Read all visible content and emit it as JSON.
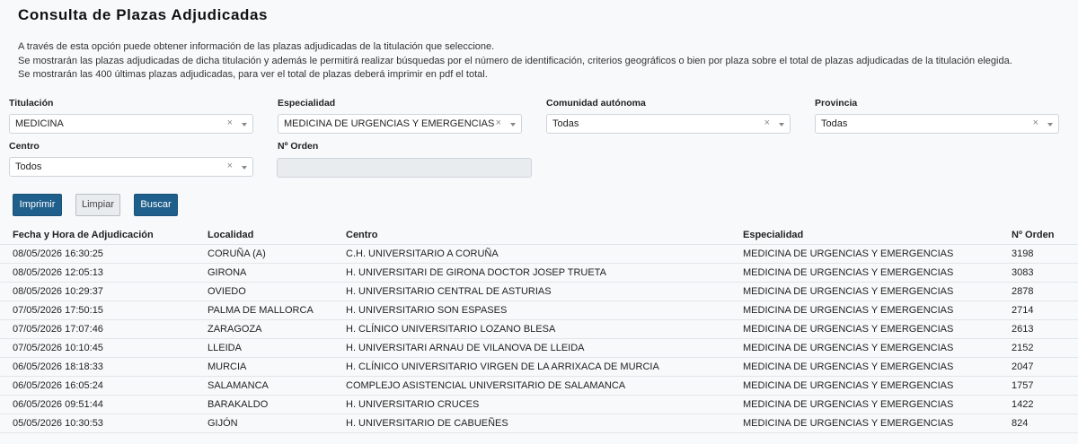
{
  "title": "Consulta de Plazas Adjudicadas",
  "intro": [
    "A través de esta opción puede obtener información de las plazas adjudicadas de la titulación que seleccione.",
    "Se mostrarán las plazas adjudicadas de dicha titulación y además le permitirá realizar búsquedas por el número de identificación, criterios geográficos o bien por plaza sobre el total de plazas adjudicadas de la titulación elegida.",
    "Se mostrarán las 400 últimas plazas adjudicadas, para ver el total de plazas deberá imprimir en pdf el total."
  ],
  "filters": {
    "titulacion": {
      "label": "Titulación",
      "value": "MEDICINA"
    },
    "especialidad": {
      "label": "Especialidad",
      "value": "MEDICINA DE URGENCIAS Y EMERGENCIAS"
    },
    "comunidad": {
      "label": "Comunidad autónoma",
      "value": "Todas"
    },
    "provincia": {
      "label": "Provincia",
      "value": "Todas"
    },
    "centro": {
      "label": "Centro",
      "value": "Todos"
    },
    "orden": {
      "label": "Nº Orden",
      "value": ""
    },
    "clear_glyph": "×"
  },
  "buttons": {
    "imprimir": "Imprimir",
    "limpiar": "Limpiar",
    "buscar": "Buscar"
  },
  "table": {
    "headers": {
      "fecha": "Fecha y Hora de Adjudicación",
      "localidad": "Localidad",
      "centro": "Centro",
      "especialidad": "Especialidad",
      "orden": "Nº Orden"
    },
    "rows": [
      {
        "fecha": "08/05/2026 16:30:25",
        "localidad": "CORUÑA (A)",
        "centro": "C.H. UNIVERSITARIO A CORUÑA",
        "especialidad": "MEDICINA DE URGENCIAS Y EMERGENCIAS",
        "orden": "3198"
      },
      {
        "fecha": "08/05/2026 12:05:13",
        "localidad": "GIRONA",
        "centro": "H. UNIVERSITARI DE GIRONA DOCTOR JOSEP TRUETA",
        "especialidad": "MEDICINA DE URGENCIAS Y EMERGENCIAS",
        "orden": "3083"
      },
      {
        "fecha": "08/05/2026 10:29:37",
        "localidad": "OVIEDO",
        "centro": "H. UNIVERSITARIO CENTRAL DE ASTURIAS",
        "especialidad": "MEDICINA DE URGENCIAS Y EMERGENCIAS",
        "orden": "2878"
      },
      {
        "fecha": "07/05/2026 17:50:15",
        "localidad": "PALMA DE MALLORCA",
        "centro": "H. UNIVERSITARIO SON ESPASES",
        "especialidad": "MEDICINA DE URGENCIAS Y EMERGENCIAS",
        "orden": "2714"
      },
      {
        "fecha": "07/05/2026 17:07:46",
        "localidad": "ZARAGOZA",
        "centro": "H. CLÍNICO UNIVERSITARIO LOZANO BLESA",
        "especialidad": "MEDICINA DE URGENCIAS Y EMERGENCIAS",
        "orden": "2613"
      },
      {
        "fecha": "07/05/2026 10:10:45",
        "localidad": "LLEIDA",
        "centro": "H. UNIVERSITARI ARNAU DE VILANOVA DE LLEIDA",
        "especialidad": "MEDICINA DE URGENCIAS Y EMERGENCIAS",
        "orden": "2152"
      },
      {
        "fecha": "06/05/2026 18:18:33",
        "localidad": "MURCIA",
        "centro": "H. CLÍNICO UNIVERSITARIO VIRGEN DE LA ARRIXACA DE MURCIA",
        "especialidad": "MEDICINA DE URGENCIAS Y EMERGENCIAS",
        "orden": "2047"
      },
      {
        "fecha": "06/05/2026 16:05:24",
        "localidad": "SALAMANCA",
        "centro": "COMPLEJO ASISTENCIAL UNIVERSITARIO DE SALAMANCA",
        "especialidad": "MEDICINA DE URGENCIAS Y EMERGENCIAS",
        "orden": "1757"
      },
      {
        "fecha": "06/05/2026 09:51:44",
        "localidad": "BARAKALDO",
        "centro": "H. UNIVERSITARIO CRUCES",
        "especialidad": "MEDICINA DE URGENCIAS Y EMERGENCIAS",
        "orden": "1422"
      },
      {
        "fecha": "05/05/2026 10:30:53",
        "localidad": "GIJÓN",
        "centro": "H. UNIVERSITARIO DE CABUEÑES",
        "especialidad": "MEDICINA DE URGENCIAS Y EMERGENCIAS",
        "orden": "824"
      }
    ]
  }
}
